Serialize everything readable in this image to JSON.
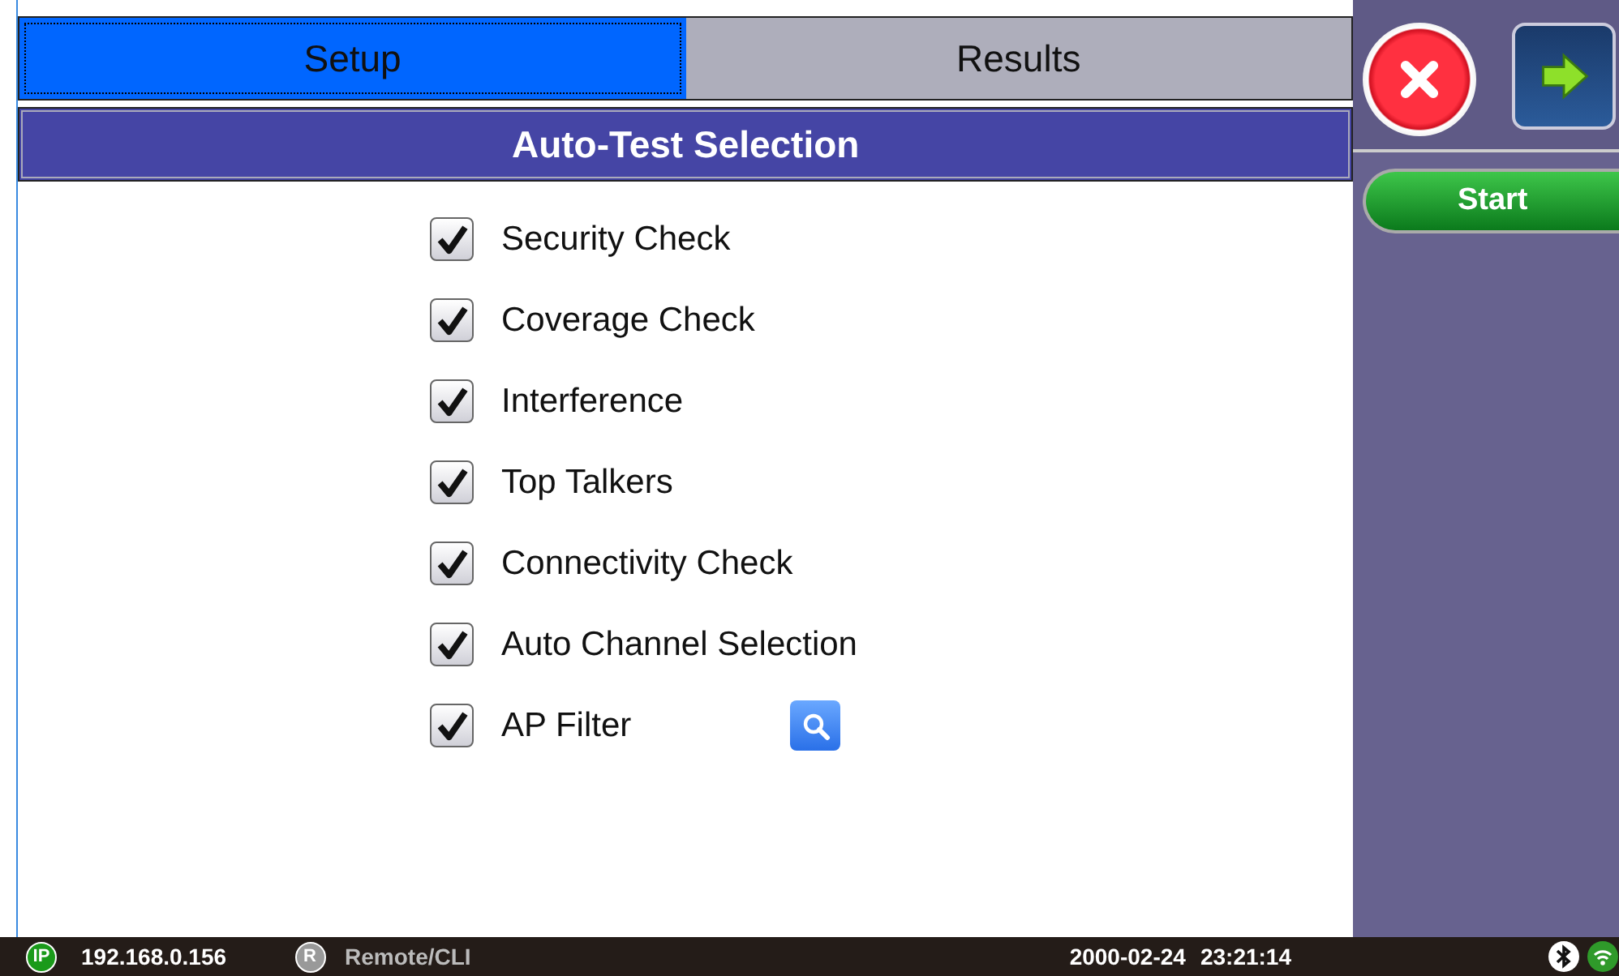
{
  "tabs": [
    {
      "label": "Setup",
      "selected": true
    },
    {
      "label": "Results",
      "selected": false
    }
  ],
  "header": "Auto-Test Selection",
  "tests": [
    {
      "label": "Security Check",
      "checked": true,
      "search_button": false
    },
    {
      "label": "Coverage Check",
      "checked": true,
      "search_button": false
    },
    {
      "label": "Interference",
      "checked": true,
      "search_button": false
    },
    {
      "label": "Top Talkers",
      "checked": true,
      "search_button": false
    },
    {
      "label": "Connectivity Check",
      "checked": true,
      "search_button": false
    },
    {
      "label": "Auto Channel Selection",
      "checked": true,
      "search_button": false
    },
    {
      "label": "AP Filter",
      "checked": true,
      "search_button": true
    }
  ],
  "side": {
    "start": "Start"
  },
  "status_bar": {
    "ip_badge": "IP",
    "ip": "192.168.0.156",
    "remote_badge": "R",
    "remote": "Remote/CLI",
    "date": "2000-02-24",
    "time": "23:21:14"
  }
}
